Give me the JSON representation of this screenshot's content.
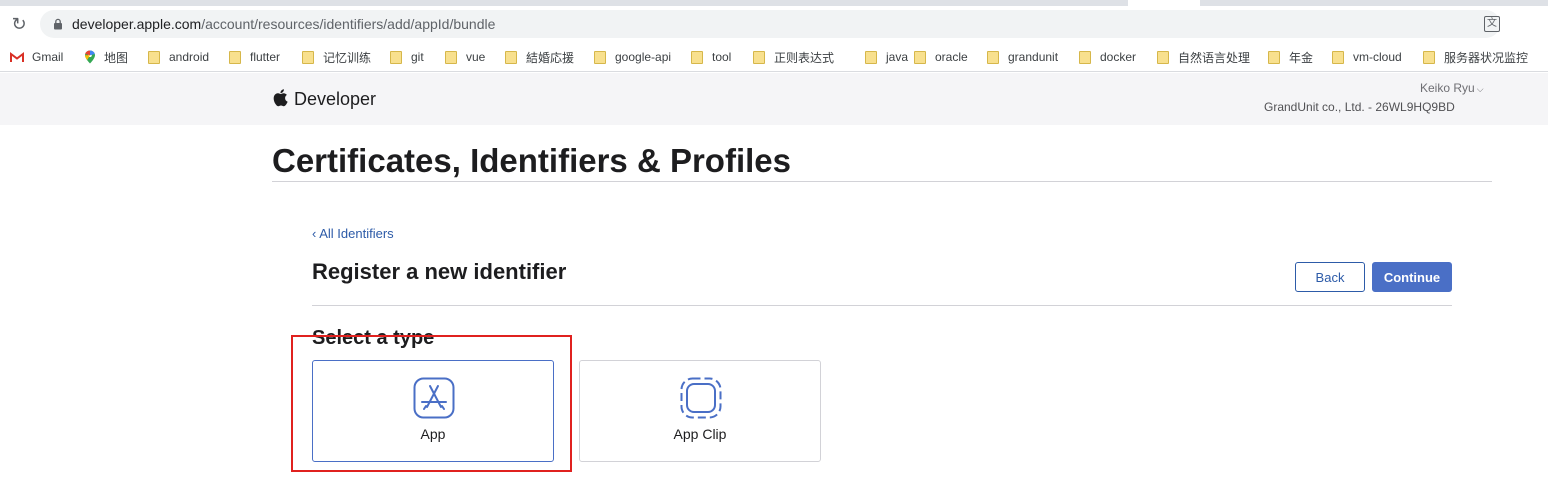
{
  "browser": {
    "url_host": "developer.apple.com",
    "url_path": "/account/resources/identifiers/add/appId/bundle",
    "bookmarks": [
      {
        "label": "Gmail",
        "icon": "gmail-icon"
      },
      {
        "label": "地图",
        "icon": "maps-icon"
      },
      {
        "label": "android",
        "icon": "folder-icon"
      },
      {
        "label": "flutter",
        "icon": "folder-icon"
      },
      {
        "label": "记忆训练",
        "icon": "folder-icon"
      },
      {
        "label": "git",
        "icon": "folder-icon"
      },
      {
        "label": "vue",
        "icon": "folder-icon"
      },
      {
        "label": "結婚応援",
        "icon": "folder-icon"
      },
      {
        "label": "google-api",
        "icon": "folder-icon"
      },
      {
        "label": "tool",
        "icon": "folder-icon"
      },
      {
        "label": "正则表达式",
        "icon": "folder-icon"
      },
      {
        "label": "java",
        "icon": "folder-icon"
      },
      {
        "label": "oracle",
        "icon": "folder-icon"
      },
      {
        "label": "grandunit",
        "icon": "folder-icon"
      },
      {
        "label": "docker",
        "icon": "folder-icon"
      },
      {
        "label": "自然语言处理",
        "icon": "folder-icon"
      },
      {
        "label": "年金",
        "icon": "folder-icon"
      },
      {
        "label": "vm-cloud",
        "icon": "folder-icon"
      },
      {
        "label": "服务器状况监控",
        "icon": "folder-icon"
      }
    ]
  },
  "header": {
    "brand": "Developer",
    "user_name": "Keiko Ryu",
    "team": "GrandUnit co., Ltd. - 26WL9HQ9BD"
  },
  "main": {
    "page_title": "Certificates, Identifiers & Profiles",
    "back_link": "‹ All Identifiers",
    "section_title": "Register a new identifier",
    "back_button": "Back",
    "continue_button": "Continue",
    "select_type_label": "Select a type",
    "types": [
      {
        "label": "App",
        "icon": "app-store-icon",
        "selected": true
      },
      {
        "label": "App Clip",
        "icon": "app-clip-icon",
        "selected": false
      }
    ]
  },
  "colors": {
    "accent": "#4a6fc6",
    "link": "#2d5ba8",
    "highlight": "#e0211f"
  }
}
